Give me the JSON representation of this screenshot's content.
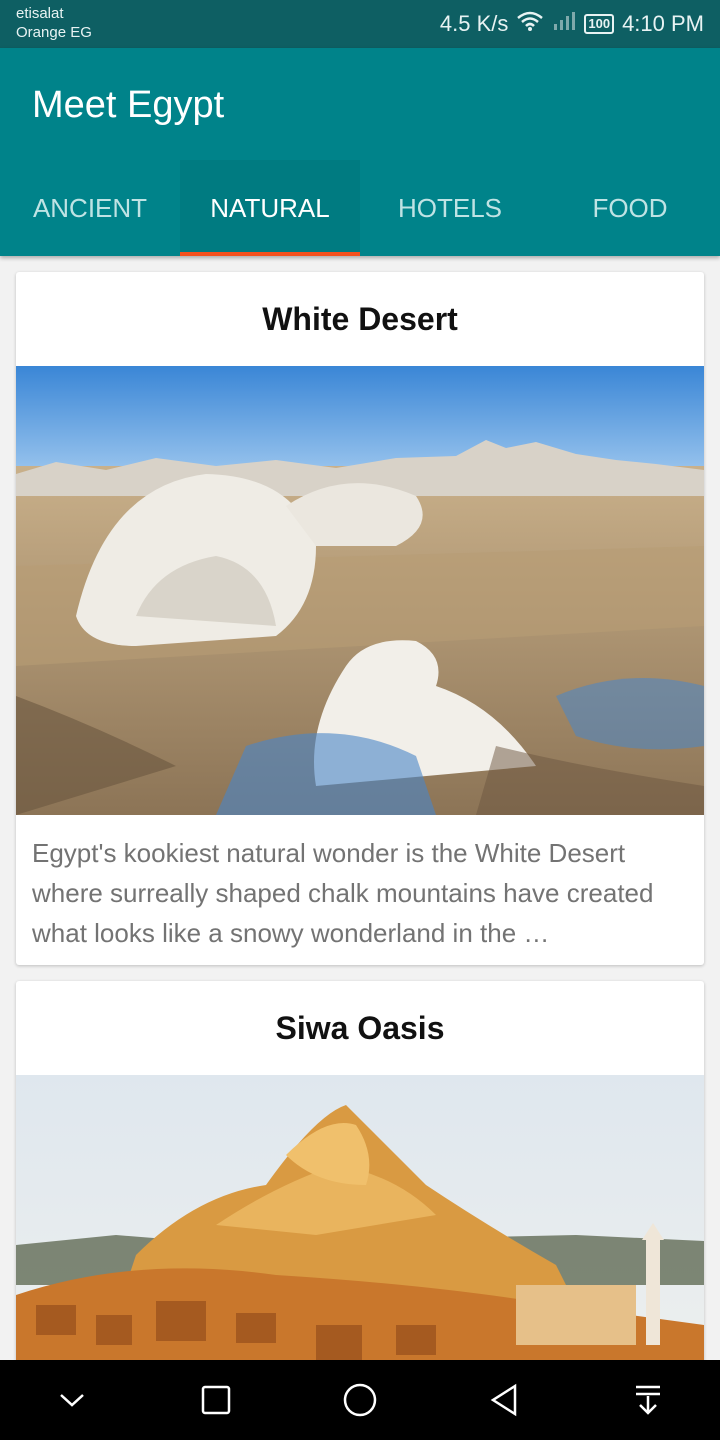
{
  "status": {
    "carrier1": "etisalat",
    "carrier2": "Orange EG",
    "speed": "4.5 K/s",
    "battery": "100",
    "time": "4:10 PM"
  },
  "app": {
    "title": "Meet Egypt"
  },
  "tabs": [
    {
      "label": "ANCIENT",
      "active": false
    },
    {
      "label": "NATURAL",
      "active": true
    },
    {
      "label": "HOTELS",
      "active": false
    },
    {
      "label": "FOOD",
      "active": false
    }
  ],
  "cards": [
    {
      "title": "White Desert",
      "image": "white-desert-photo",
      "description": "Egypt's kookiest natural wonder is the White Desert where surreally shaped chalk mountains have created what looks like a snowy wonderland in the …"
    },
    {
      "title": "Siwa Oasis",
      "image": "siwa-oasis-photo",
      "description": ""
    }
  ],
  "colors": {
    "primary": "#00838a",
    "status_bar": "#0e5f63",
    "tab_indicator": "#f4511e"
  },
  "nav_icons": [
    "chevron-down-icon",
    "square-icon",
    "circle-icon",
    "back-triangle-icon",
    "download-icon"
  ]
}
